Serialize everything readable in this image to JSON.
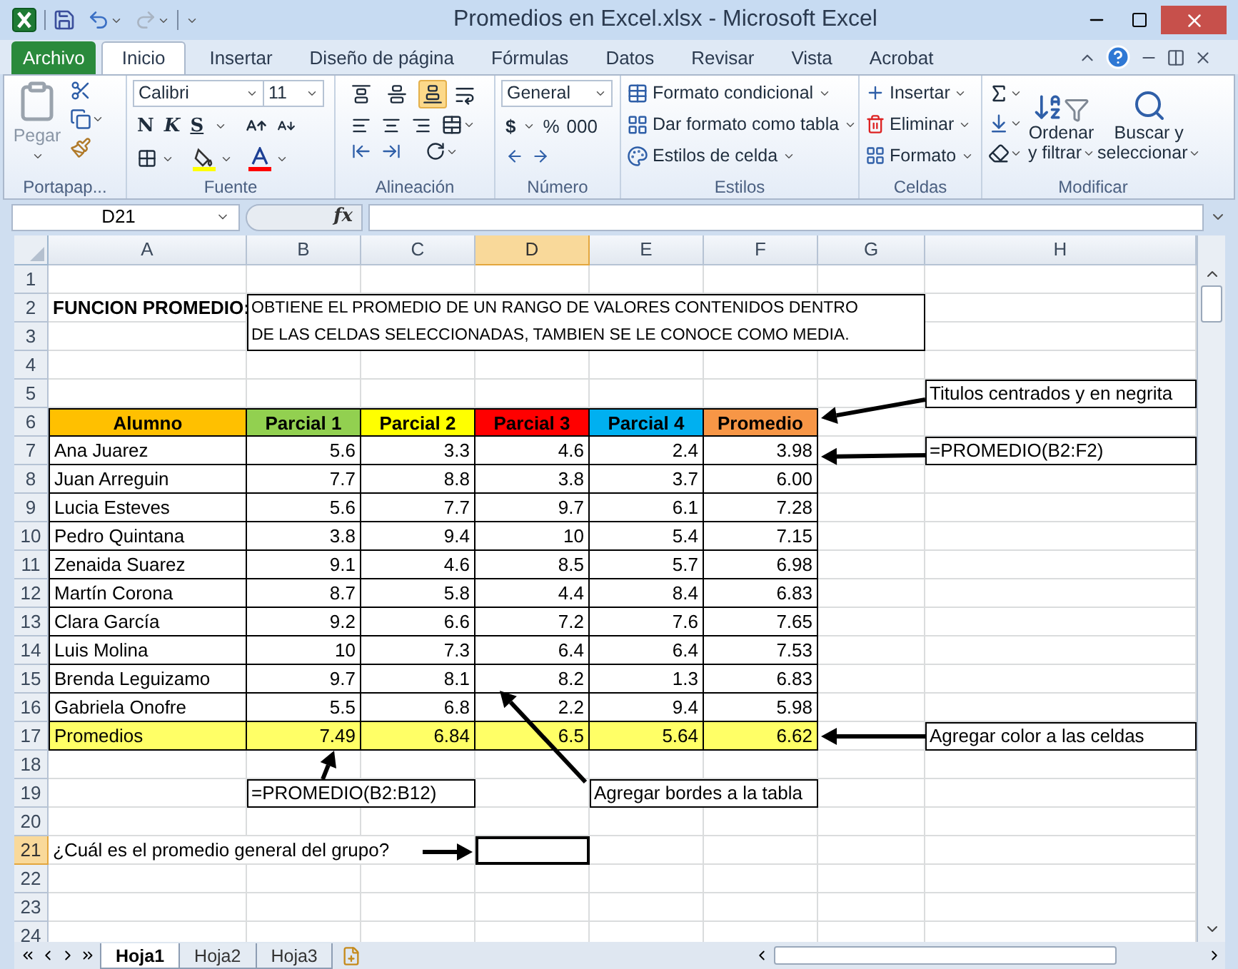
{
  "title": "Promedios en Excel.xlsx - Microsoft Excel",
  "ribbon_tabs": [
    {
      "label": "Archivo",
      "kind": "file",
      "selected": false
    },
    {
      "label": "Inicio",
      "kind": "tab",
      "selected": true
    },
    {
      "label": "Insertar",
      "kind": "tab",
      "selected": false
    },
    {
      "label": "Diseño de página",
      "kind": "tab",
      "selected": false
    },
    {
      "label": "Fórmulas",
      "kind": "tab",
      "selected": false
    },
    {
      "label": "Datos",
      "kind": "tab",
      "selected": false
    },
    {
      "label": "Revisar",
      "kind": "tab",
      "selected": false
    },
    {
      "label": "Vista",
      "kind": "tab",
      "selected": false
    },
    {
      "label": "Acrobat",
      "kind": "tab",
      "selected": false
    }
  ],
  "ribbon": {
    "clipboard": {
      "label": "Portapap...",
      "paste": {
        "label": "Pegar",
        "disabled": true
      }
    },
    "font": {
      "label": "Fuente",
      "family": "Calibri",
      "size": "11",
      "styles": [
        "N",
        "K",
        "S"
      ]
    },
    "alignment": {
      "label": "Alineación",
      "vertical": [
        {
          "selected": false
        },
        {
          "selected": false
        },
        {
          "selected": true
        }
      ]
    },
    "number": {
      "label": "Número",
      "format": "General",
      "symbols": [
        "$",
        "%",
        "000"
      ]
    },
    "styles": {
      "label": "Estilos",
      "items": [
        "Formato condicional",
        "Dar formato como tabla",
        "Estilos de celda"
      ]
    },
    "cells": {
      "label": "Celdas",
      "items": [
        "Insertar",
        "Eliminar",
        "Formato"
      ]
    },
    "editing": {
      "label": "Modificar",
      "sort": [
        "Ordenar",
        "y filtrar"
      ],
      "find": [
        "Buscar y",
        "seleccionar"
      ]
    }
  },
  "name_box": "D21",
  "function_label": "fx",
  "columns": [
    {
      "label": "A",
      "selected": false
    },
    {
      "label": "B",
      "selected": false
    },
    {
      "label": "C",
      "selected": false
    },
    {
      "label": "D",
      "selected": true
    },
    {
      "label": "E",
      "selected": false
    },
    {
      "label": "F",
      "selected": false
    },
    {
      "label": "G",
      "selected": false
    },
    {
      "label": "H",
      "selected": false
    }
  ],
  "rows": [
    {
      "label": "1",
      "selected": false
    },
    {
      "label": "2",
      "selected": false
    },
    {
      "label": "3",
      "selected": false
    },
    {
      "label": "4",
      "selected": false
    },
    {
      "label": "5",
      "selected": false
    },
    {
      "label": "6",
      "selected": false
    },
    {
      "label": "7",
      "selected": false
    },
    {
      "label": "8",
      "selected": false
    },
    {
      "label": "9",
      "selected": false
    },
    {
      "label": "10",
      "selected": false
    },
    {
      "label": "11",
      "selected": false
    },
    {
      "label": "12",
      "selected": false
    },
    {
      "label": "13",
      "selected": false
    },
    {
      "label": "14",
      "selected": false
    },
    {
      "label": "15",
      "selected": false
    },
    {
      "label": "16",
      "selected": false
    },
    {
      "label": "17",
      "selected": false
    },
    {
      "label": "18",
      "selected": false
    },
    {
      "label": "19",
      "selected": false
    },
    {
      "label": "20",
      "selected": false
    },
    {
      "label": "21",
      "selected": true
    },
    {
      "label": "22",
      "selected": false
    },
    {
      "label": "23",
      "selected": false
    },
    {
      "label": "24",
      "selected": false
    }
  ],
  "definition": {
    "title": "FUNCION PROMEDIO:",
    "lines": [
      "OBTIENE EL PROMEDIO DE UN RANGO DE VALORES CONTENIDOS DENTRO",
      "DE LAS CELDAS SELECCIONADAS, TAMBIEN SE LE CONOCE COMO MEDIA."
    ]
  },
  "table": {
    "headers": [
      {
        "text": "Alumno",
        "color": "#ffc000"
      },
      {
        "text": "Parcial 1",
        "color": "#92d050"
      },
      {
        "text": "Parcial 2",
        "color": "#ffff00"
      },
      {
        "text": "Parcial 3",
        "color": "#ff0000"
      },
      {
        "text": "Parcial 4",
        "color": "#00b0f0"
      },
      {
        "text": "Promedio",
        "color": "#f79646"
      }
    ],
    "rows": [
      [
        "Ana Juarez",
        "5.6",
        "3.3",
        "4.6",
        "2.4",
        "3.98"
      ],
      [
        "Juan Arreguin",
        "7.7",
        "8.8",
        "3.8",
        "3.7",
        "6.00"
      ],
      [
        "Lucia Esteves",
        "5.6",
        "7.7",
        "9.7",
        "6.1",
        "7.28"
      ],
      [
        "Pedro Quintana",
        "3.8",
        "9.4",
        "10",
        "5.4",
        "7.15"
      ],
      [
        "Zenaida Suarez",
        "9.1",
        "4.6",
        "8.5",
        "5.7",
        "6.98"
      ],
      [
        "Martín Corona",
        "8.7",
        "5.8",
        "4.4",
        "8.4",
        "6.83"
      ],
      [
        "Clara García",
        "9.2",
        "6.6",
        "7.2",
        "7.6",
        "7.65"
      ],
      [
        "Luis Molina",
        "10",
        "7.3",
        "6.4",
        "6.4",
        "7.53"
      ],
      [
        "Brenda Leguizamo",
        "9.7",
        "8.1",
        "8.2",
        "1.3",
        "6.83"
      ],
      [
        "Gabriela Onofre",
        "5.5",
        "6.8",
        "2.2",
        "9.4",
        "5.98"
      ]
    ],
    "totals": {
      "color": "#ffff66",
      "cells": [
        "Promedios",
        "7.49",
        "6.84",
        "6.5",
        "5.64",
        "6.62"
      ]
    }
  },
  "notes": [
    {
      "text": "Titulos centrados y en negrita"
    },
    {
      "text": "=PROMEDIO(B2:F2)"
    },
    {
      "text": "Agregar color a las celdas"
    },
    {
      "text": "=PROMEDIO(B2:B12)"
    },
    {
      "text": "Agregar bordes a la tabla"
    }
  ],
  "question": "¿Cuál es el promedio general del grupo?",
  "sheet_tabs": [
    {
      "label": "Hoja1",
      "selected": true
    },
    {
      "label": "Hoja2",
      "selected": false
    },
    {
      "label": "Hoja3",
      "selected": false
    }
  ]
}
